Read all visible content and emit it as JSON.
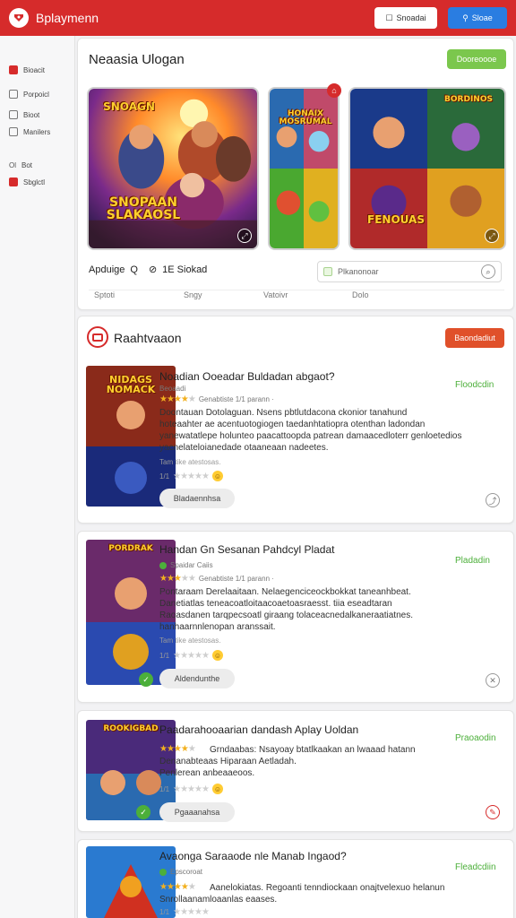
{
  "header": {
    "app_title": "Bplaymenn",
    "btn_white_label": "Snoadai",
    "btn_blue_label": "Sloae",
    "colors": {
      "brand": "#d62b2b",
      "blue": "#2a7de1",
      "green": "#7bc74d"
    }
  },
  "sidebar": {
    "items": [
      {
        "icon": "home-icon",
        "label": "Bioacit"
      },
      {
        "icon": "people-icon",
        "label": "Porpoicl"
      },
      {
        "icon": "star-icon",
        "label": "Bioot"
      },
      {
        "icon": "list-icon",
        "label": "Manilers"
      },
      {
        "icon_text": "Ol",
        "label": "Bot"
      },
      {
        "icon": "settings-icon",
        "label": "Sbglctl"
      }
    ]
  },
  "featured": {
    "title": "Neaasia Ulogan",
    "action_label": "Dooreoooe",
    "art": {
      "main": "SNOAGN",
      "main_caption": "SNOPAAN\nSLAKAOSL",
      "mid_top": "HONAIX\nMOSRUMAL",
      "right_top": "BORDINOS",
      "right_bottom": "FENOUAS"
    },
    "row_label": "Apduige",
    "row_mid": "Q",
    "row_right": "1E Siokad",
    "search_placeholder": "Plkanonoar",
    "tabs": [
      "Sptoti",
      "Sngy",
      "Vatoivr",
      "Dolo"
    ]
  },
  "section": {
    "title": "Raahtvaaon",
    "action_label": "Baondadiut"
  },
  "games": [
    {
      "title": "Noadian Ooeadar Buldadan abgaot?",
      "sub_tag": "Beoaadi",
      "meta": "Genabtiste   1/1 parann  ·",
      "desc_lines": [
        "Doontauan Dotolaguan. Nsens pbtlutdacona ckonior tanahund",
        "hoteaahter ae acentuotogiogen taedanhtatiopra otenthan ladondan",
        "yanewatatlepe holunteo paacattoopda patrean damaacedloterr genloetedios",
        "yacnelateloianedade otaaneaan nadeetes."
      ],
      "small": "Tam tike atestosas.",
      "rating_text": "1/1",
      "action": "Bladaennhsa",
      "status": "Floodcdin",
      "stars": 3.5,
      "art": "NIDAGS\nNOMACK"
    },
    {
      "title": "Handan Gn Sesanan Pahdcyl Pladat",
      "sub_tag": "Spaidar Caiis",
      "meta": "Genabtiste   1/1 parann  ·",
      "desc_lines": [
        "Pontaraam Derelaaitaan. Nelaegenciceockbokkat taneanhbeat.",
        "Danetiatlas teneacoatloitaacoaetoasraesst. tiia eseadtaran",
        "Raoasdanen tarqpecsoatl giraang tolaceacnedalkaneraatiatnes.",
        "hanhaarnnlenopan aranssait."
      ],
      "small": "Tam tike atestosas.",
      "rating_text": "1/1",
      "action": "Aldendunthe",
      "status": "Pladadin",
      "stars": 3,
      "art": "PORDRAK"
    },
    {
      "title": "Paadarahooaarian dandash Aplay Uoldan",
      "sub_tag": "",
      "meta": "",
      "desc_lines": [
        "Grndaabas: Nsayoay btatlkaakan an lwaaad hatann",
        "Denanabteaas Hiparaan Aetladah.",
        "Penlerean anbeaaeoos."
      ],
      "small": "",
      "rating_text": "1/1",
      "action": "Pgaaanahsa",
      "status": "Praoaodin",
      "stars": 4,
      "art": "ROOKIGBAD"
    },
    {
      "title": "Avaonga Saraaode nle Manab Ingaod?",
      "sub_tag": "Epscoroat",
      "meta": "",
      "desc_lines": [
        "Aanelokiatas. Regoanti tenndiockaan onajtvelexuo helanun",
        "Snrollaanamloaanlas eaases."
      ],
      "small": "",
      "rating_text": "1/1",
      "action": "",
      "status": "Fleadcdiin",
      "stars": 4,
      "art": ""
    }
  ]
}
